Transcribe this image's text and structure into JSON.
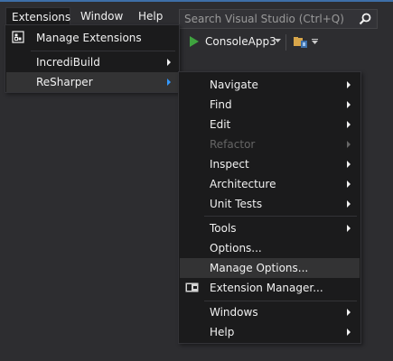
{
  "menubar": {
    "items": [
      {
        "label": "Extensions"
      },
      {
        "label": "Window"
      },
      {
        "label": "Help"
      }
    ],
    "search_placeholder": "Search Visual Studio (Ctrl+Q)"
  },
  "toolbar": {
    "run_target": "ConsoleApp3"
  },
  "extensions_menu": {
    "items": [
      {
        "label": "Manage Extensions"
      },
      {
        "label": "IncrediBuild"
      },
      {
        "label": "ReSharper"
      }
    ]
  },
  "resharper_menu": {
    "items": [
      {
        "label": "Navigate"
      },
      {
        "label": "Find"
      },
      {
        "label": "Edit"
      },
      {
        "label": "Refactor"
      },
      {
        "label": "Inspect"
      },
      {
        "label": "Architecture"
      },
      {
        "label": "Unit Tests"
      },
      {
        "label": "Tools"
      },
      {
        "label": "Options..."
      },
      {
        "label": "Manage Options..."
      },
      {
        "label": "Extension Manager..."
      },
      {
        "label": "Windows"
      },
      {
        "label": "Help"
      }
    ]
  },
  "colors": {
    "background": "#2d2d30",
    "menu_bg": "#1b1b1c",
    "highlight": "#333334",
    "accent": "#3399ff",
    "run_green": "#3fa33f",
    "disabled_text": "#656565"
  }
}
